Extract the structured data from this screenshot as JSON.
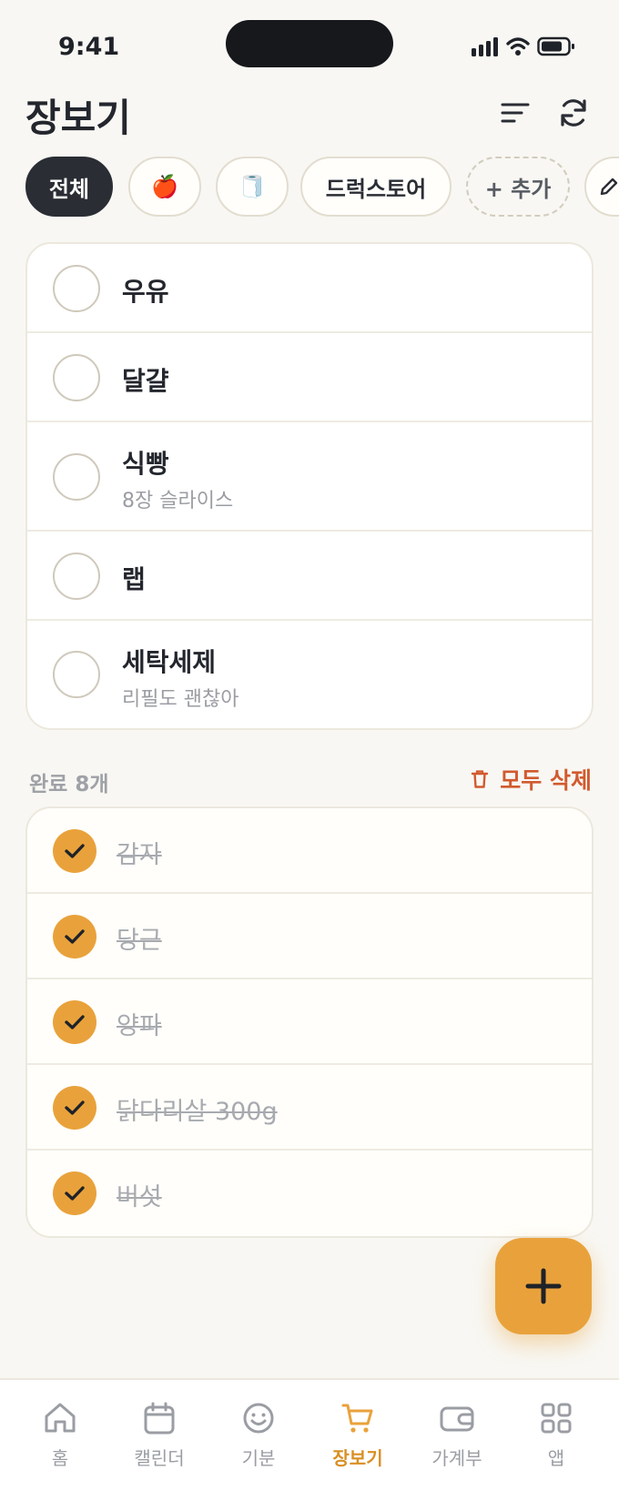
{
  "status_bar": {
    "time": "9:41"
  },
  "header": {
    "title": "장보기"
  },
  "categories": [
    {
      "label": "전체",
      "active": true
    },
    {
      "label": "🍎",
      "active": false
    },
    {
      "label": "🧻",
      "active": false
    },
    {
      "label": "드럭스토어",
      "active": false
    },
    {
      "label": "+ 추가",
      "active": false
    }
  ],
  "pending_items": [
    {
      "title": "우유",
      "note": ""
    },
    {
      "title": "달걀",
      "note": ""
    },
    {
      "title": "식빵",
      "note": "8장 슬라이스"
    },
    {
      "title": "랩",
      "note": ""
    },
    {
      "title": "세탁세제",
      "note": "리필도 괜찮아"
    }
  ],
  "completed": {
    "count_label": "완료 8개",
    "delete_all_label": "모두 삭제",
    "items": [
      "감자",
      "당근",
      "양파",
      "닭다리살 300g",
      "버섯"
    ]
  },
  "tabbar": {
    "tabs": [
      {
        "label": "홈",
        "icon": "home-icon",
        "active": false
      },
      {
        "label": "캘린더",
        "icon": "calendar-icon",
        "active": false
      },
      {
        "label": "기분",
        "icon": "smile-icon",
        "active": false
      },
      {
        "label": "장보기",
        "icon": "cart-icon",
        "active": true
      },
      {
        "label": "가계부",
        "icon": "wallet-icon",
        "active": false
      },
      {
        "label": "앱",
        "icon": "grid-icon",
        "active": false
      }
    ]
  },
  "colors": {
    "accent": "#E9A23B",
    "danger": "#D15A2E",
    "background": "#F8F7F3",
    "chip_active": "#2A2D34"
  }
}
